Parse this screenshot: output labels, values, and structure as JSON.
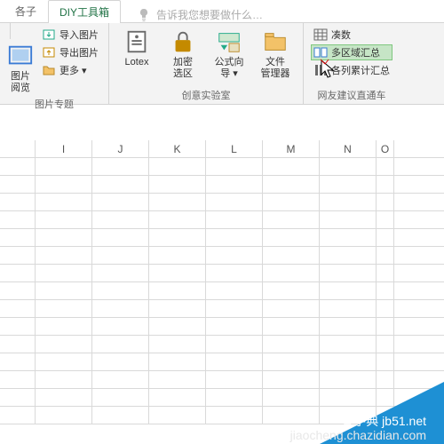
{
  "tabs": {
    "t0": "各子",
    "t1": "DIY工具箱",
    "tellme_icon": "lightbulb",
    "tellme": "告诉我您想要做什么…"
  },
  "group1": {
    "label": "图片专题",
    "big0": "图片\n阅览",
    "s0": "导入图片",
    "s1": "导出图片",
    "s2": "更多 ▾"
  },
  "group2": {
    "label": "创意实验室",
    "big0": "Lotex",
    "big1": "加密\n选区",
    "big2": "公式向\n导 ▾",
    "big3": "文件\n管理器"
  },
  "group3": {
    "label": "网友建议直通车",
    "s0": "凑数",
    "s1": "多区域汇总",
    "s2": "各列累计汇总"
  },
  "columns": [
    "I",
    "J",
    "K",
    "L",
    "M",
    "N",
    "O"
  ],
  "footer": {
    "wm1": "查字典  jb51.net",
    "wm2": "jiaocheng.chazidian.com"
  }
}
